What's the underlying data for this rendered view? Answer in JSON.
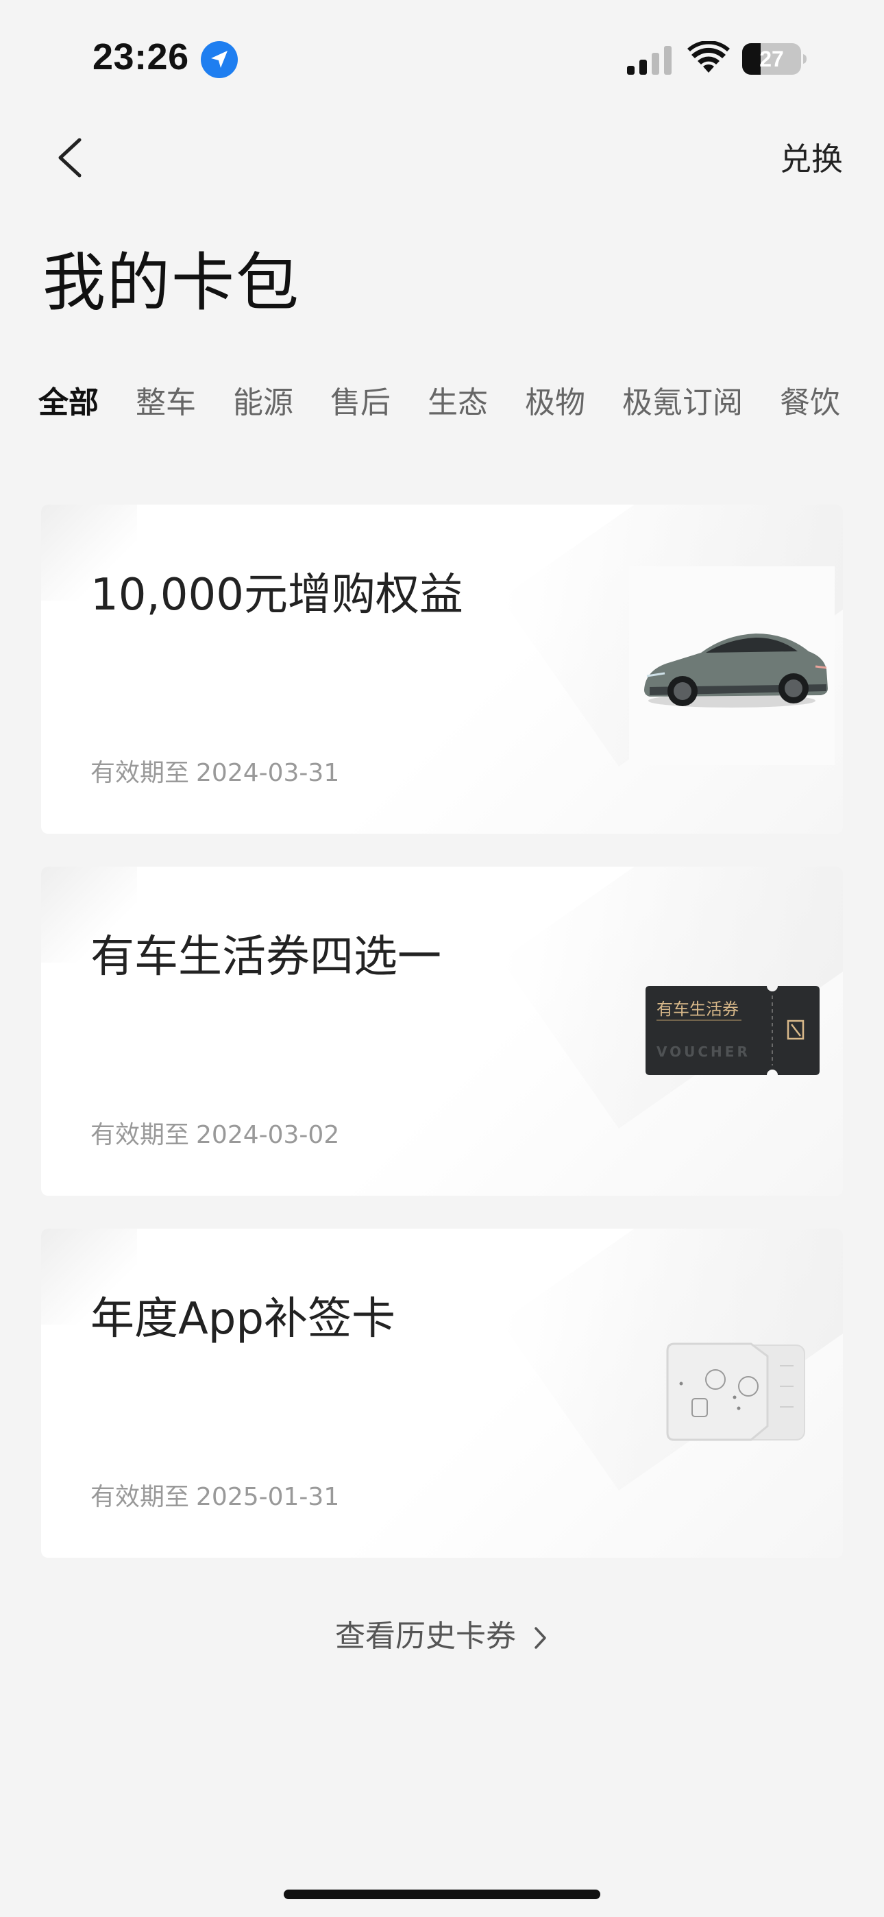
{
  "status_bar": {
    "time": "23:26",
    "battery": "27",
    "icons": [
      "location-arrow-icon",
      "signal-icon",
      "wifi-icon",
      "battery-icon"
    ]
  },
  "nav": {
    "back_icon": "chevron-left-icon",
    "redeem_label": "兑换"
  },
  "page": {
    "title": "我的卡包"
  },
  "tabs": [
    {
      "label": "全部",
      "active": true
    },
    {
      "label": "整车",
      "active": false
    },
    {
      "label": "能源",
      "active": false
    },
    {
      "label": "售后",
      "active": false
    },
    {
      "label": "生态",
      "active": false
    },
    {
      "label": "极物",
      "active": false
    },
    {
      "label": "极氪订阅",
      "active": false
    },
    {
      "label": "餐饮",
      "active": false
    }
  ],
  "cards": [
    {
      "title": "10,000元增购权益",
      "expiry_label": "有效期至",
      "expiry_date": "2024-03-31",
      "image": "car-image"
    },
    {
      "title": "有车生活券四选一",
      "expiry_label": "有效期至",
      "expiry_date": "2024-03-02",
      "image": "voucher-ticket-image",
      "ticket_label": "有车生活券",
      "ticket_sub": "VOUCHER"
    },
    {
      "title": "年度App补签卡",
      "expiry_label": "有效期至",
      "expiry_date": "2025-01-31",
      "image": "makeup-card-image"
    }
  ],
  "footer": {
    "history_label": "查看历史卡券",
    "history_icon": "chevron-right-icon"
  },
  "colors": {
    "background": "#f4f4f4",
    "card": "#ffffff",
    "text_primary": "#222222",
    "text_secondary": "#999999",
    "ticket_dark": "#2a2c2e",
    "ticket_gold": "#d9b98a",
    "location_blue": "#1e7ef0"
  }
}
